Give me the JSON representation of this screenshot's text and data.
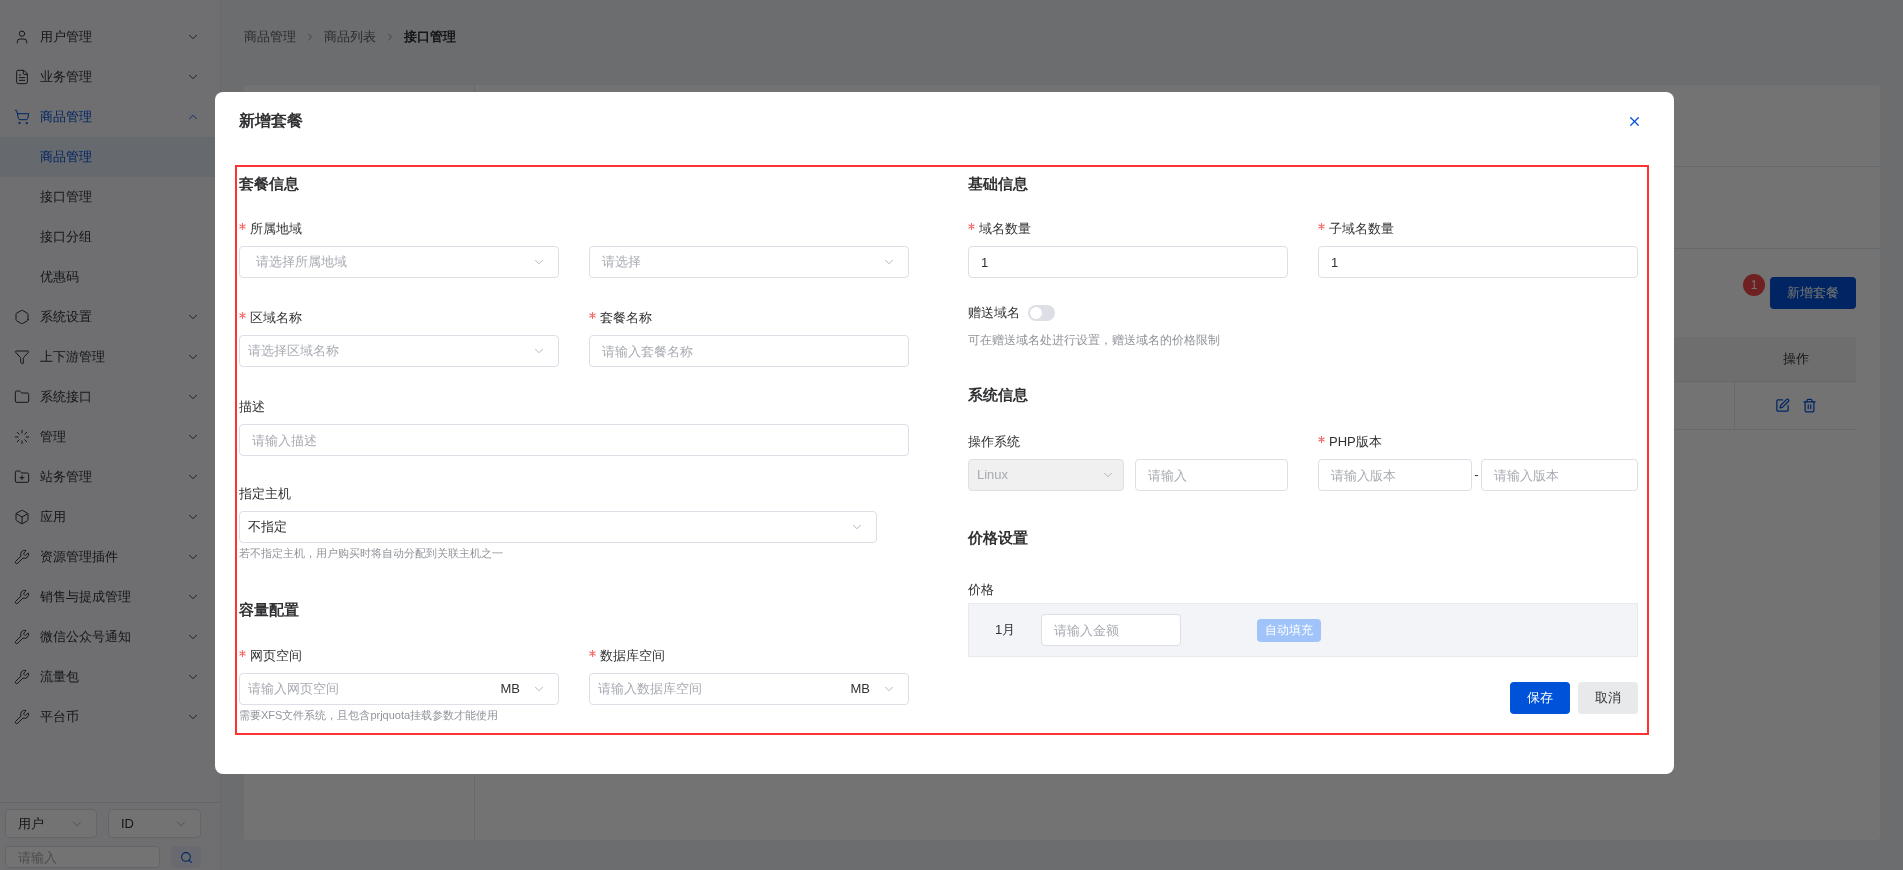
{
  "sidebar": {
    "items": [
      {
        "label": "用户管理",
        "expanded": false
      },
      {
        "label": "业务管理",
        "expanded": false
      },
      {
        "label": "商品管理",
        "expanded": true,
        "children": [
          {
            "label": "商品管理",
            "selected": true
          },
          {
            "label": "接口管理",
            "selected": false
          },
          {
            "label": "接口分组",
            "selected": false
          },
          {
            "label": "优惠码",
            "selected": false
          }
        ]
      },
      {
        "label": "系统设置",
        "expanded": false
      },
      {
        "label": "上下游管理",
        "expanded": false
      },
      {
        "label": "系统接口",
        "expanded": false
      },
      {
        "label": "管理",
        "expanded": false
      },
      {
        "label": "站务管理",
        "expanded": false
      },
      {
        "label": "应用",
        "expanded": false
      },
      {
        "label": "资源管理插件",
        "expanded": false
      },
      {
        "label": "销售与提成管理",
        "expanded": false
      },
      {
        "label": "微信公众号通知",
        "expanded": false
      },
      {
        "label": "流量包",
        "expanded": false
      },
      {
        "label": "平台币",
        "expanded": false
      }
    ],
    "search": {
      "type": "用户",
      "field": "ID",
      "placeholder": "请输入"
    }
  },
  "breadcrumb": [
    "商品管理",
    "商品列表",
    "接口管理"
  ],
  "toolbar": {
    "badge": "1",
    "add_button": "新增套餐"
  },
  "table": {
    "columns": [
      "操作"
    ]
  },
  "dialog": {
    "title": "新增套餐",
    "package_info": {
      "heading": "套餐信息",
      "region": {
        "label": "所属地域",
        "required": true,
        "placeholder": "请选择所属地域",
        "second_placeholder": "请选择"
      },
      "zone": {
        "label": "区域名称",
        "required": true,
        "placeholder": "请选择区域名称"
      },
      "package_name": {
        "label": "套餐名称",
        "required": true,
        "placeholder": "请输入套餐名称"
      },
      "description": {
        "label": "描述",
        "required": false,
        "placeholder": "请输入描述"
      },
      "host": {
        "label": "指定主机",
        "required": false,
        "value": "不指定",
        "hint": "若不指定主机，用户购买时将自动分配到关联主机之一"
      }
    },
    "capacity": {
      "heading": "容量配置",
      "web_space": {
        "label": "网页空间",
        "required": true,
        "placeholder": "请输入网页空间",
        "unit": "MB"
      },
      "db_space": {
        "label": "数据库空间",
        "required": true,
        "placeholder": "请输入数据库空间",
        "unit": "MB"
      },
      "hint": "需要XFS文件系统，且包含prjquota挂载参数才能使用"
    },
    "basic_info": {
      "heading": "基础信息",
      "domain_count": {
        "label": "域名数量",
        "required": true,
        "value": "1"
      },
      "subdomain_count": {
        "label": "子域名数量",
        "required": true,
        "value": "1"
      },
      "gift_domain": {
        "label": "赠送域名",
        "on": false,
        "hint": "可在赠送域名处进行设置，赠送域名的价格限制"
      }
    },
    "system_info": {
      "heading": "系统信息",
      "os": {
        "label": "操作系统",
        "required": false,
        "value": "Linux",
        "disabled": true,
        "placeholder": "请输入"
      },
      "php": {
        "label": "PHP版本",
        "required": true,
        "min_placeholder": "请输入版本",
        "separator": "-",
        "max_placeholder": "请输入版本"
      }
    },
    "pricing": {
      "heading": "价格设置",
      "label": "价格",
      "rows": [
        {
          "period": "1月",
          "placeholder": "请输入金额",
          "autofill": "自动填充",
          "autofill_disabled": true
        }
      ]
    },
    "buttons": [
      {
        "label": "保存",
        "kind": "primary"
      },
      {
        "label": "取消",
        "kind": "default"
      }
    ]
  }
}
